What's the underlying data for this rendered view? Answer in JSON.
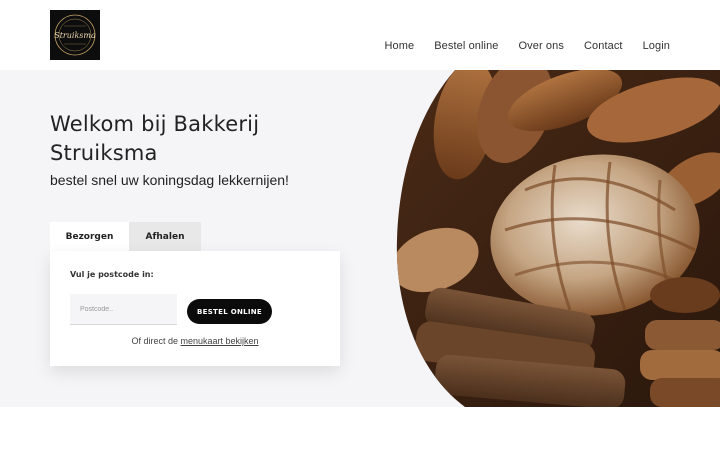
{
  "header": {
    "logo_alt": "Bakkerij Struiksma",
    "logo_text": "Struiksma",
    "nav": [
      {
        "label": "Home"
      },
      {
        "label": "Bestel online"
      },
      {
        "label": "Over ons"
      },
      {
        "label": "Contact"
      },
      {
        "label": "Login"
      }
    ]
  },
  "hero": {
    "title": "Welkom bij Bakkerij Struiksma",
    "subtitle": "bestel snel uw koningsdag lekkernijen!",
    "tabs": [
      {
        "label": "Bezorgen",
        "active": true
      },
      {
        "label": "Afhalen",
        "active": false
      }
    ],
    "form": {
      "label": "Vul je postcode in:",
      "postcode_placeholder": "Postcode..",
      "button_label": "BESTEL ONLINE",
      "menu_prefix": "Of direct de",
      "menu_link": "menukaart bekijken"
    }
  },
  "colors": {
    "hero_bg": "#f5f5f7",
    "button_bg": "#0b0b0b",
    "logo_bg": "#0d0d0d"
  }
}
